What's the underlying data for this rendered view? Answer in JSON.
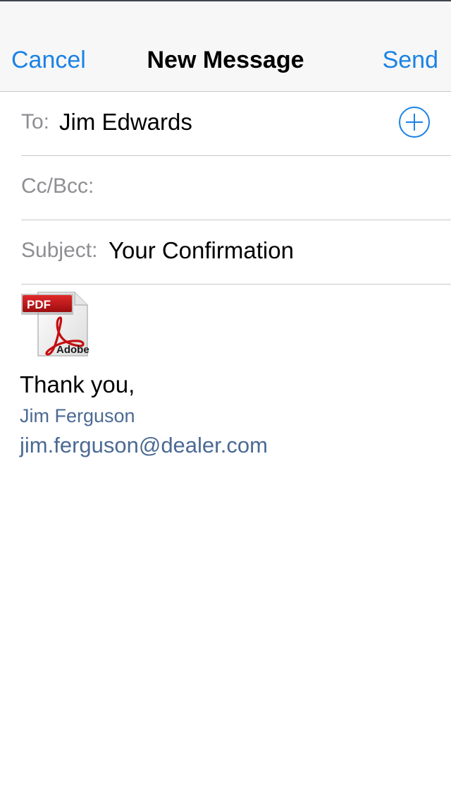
{
  "navbar": {
    "cancel_label": "Cancel",
    "title": "New Message",
    "send_label": "Send",
    "accent_color": "#1a82e6"
  },
  "fields": {
    "to": {
      "label": "To:",
      "value": "Jim Edwards",
      "add_icon": "plus-circle-icon"
    },
    "ccbcc": {
      "label": "Cc/Bcc:",
      "value": ""
    },
    "subject": {
      "label": "Subject:",
      "value": "Your Confirmation"
    }
  },
  "attachment": {
    "icon": "pdf-file-icon",
    "badge": "PDF",
    "brand": "Adobe"
  },
  "body": {
    "greeting": "Thank you,",
    "signature_name": "Jim Ferguson",
    "signature_email": "jim.ferguson@dealer.com",
    "signature_color": "#4b6a93"
  }
}
